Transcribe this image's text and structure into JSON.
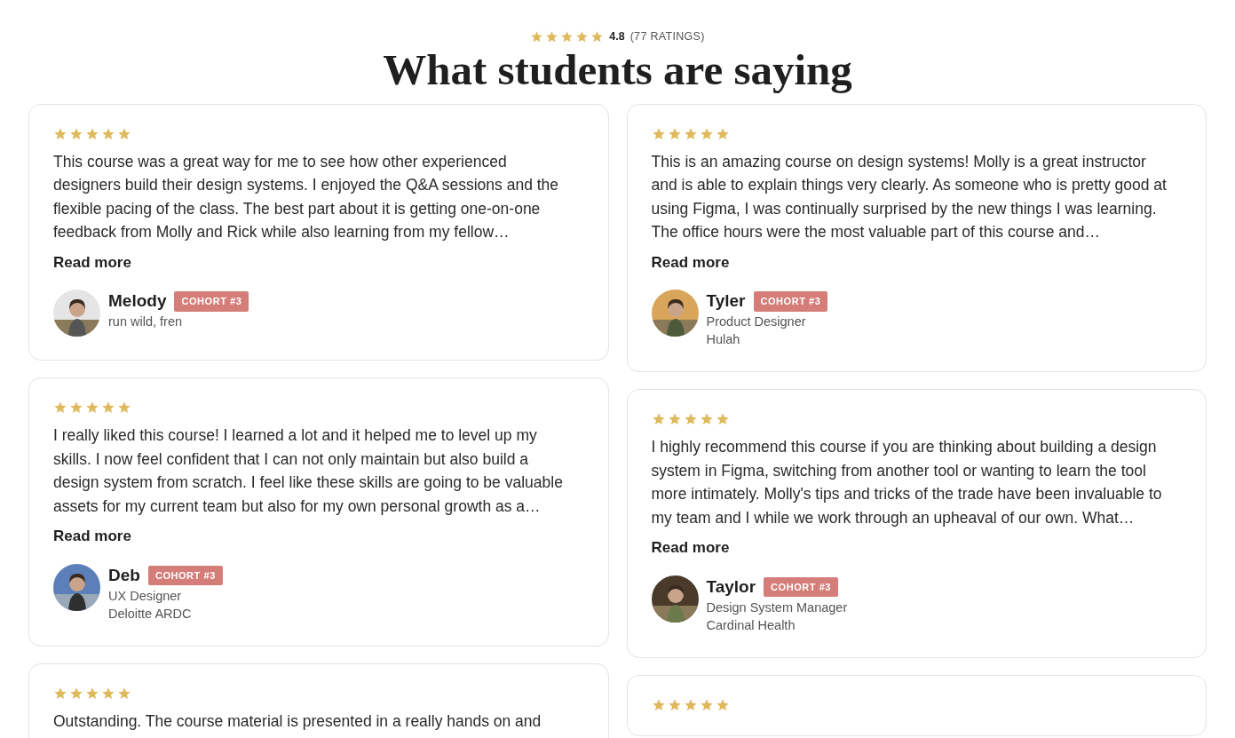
{
  "header": {
    "stars": 5,
    "rating": "4.8",
    "count": "(77 RATINGS)",
    "title": "What students are saying"
  },
  "columns": [
    {
      "reviews": [
        {
          "stars": 5,
          "text": "This course was a great way for me to see how other experienced designers build their design systems. I enjoyed the Q&A sessions and the flexible pacing of the class. The best part about it is getting one-on-one feedback from Molly and Rick while also learning from my fellow…",
          "link": "Read more",
          "name": "Melody",
          "badge": "COHORT #3",
          "lines": [
            "run wild, fren"
          ]
        },
        {
          "stars": 5,
          "text": "I really liked this course! I learned a lot and it helped me to level up my skills. I now feel confident that I can not only maintain but also build a design system from scratch. I feel like these skills are going to be valuable assets for my current team but also for my own personal growth as a…",
          "link": "Read more",
          "name": "Deb",
          "badge": "COHORT #3",
          "lines": [
            "UX Designer",
            "Deloitte ARDC"
          ]
        },
        {
          "stars": 5,
          "text": "Outstanding. The course material is presented in a really hands on and"
        }
      ]
    },
    {
      "reviews": [
        {
          "stars": 5,
          "text": "This is an amazing course on design systems! Molly is a great instructor and is able to explain things very clearly. As someone who is pretty good at using Figma, I was continually surprised by the new things I was learning. The office hours were the most valuable part of this course and…",
          "link": "Read more",
          "name": "Tyler",
          "badge": "COHORT #3",
          "lines": [
            "Product Designer",
            "Hulah"
          ]
        },
        {
          "stars": 5,
          "text": "I highly recommend this course if you are thinking about building a design system in Figma, switching from another tool or wanting to learn the tool more intimately. Molly's tips and tricks of the trade have been invaluable to my team and I while we work through an upheaval of our own. What…",
          "link": "Read more",
          "name": "Taylor",
          "badge": "COHORT #3",
          "lines": [
            "Design System Manager",
            "Cardinal Health"
          ]
        },
        {
          "stars": 5
        }
      ]
    }
  ]
}
